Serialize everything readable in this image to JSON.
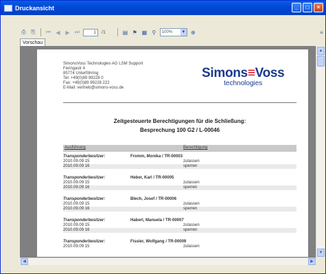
{
  "window": {
    "title": "Druckansicht"
  },
  "toolbar": {
    "page_value": "1",
    "page_total": "/1",
    "zoom_value": "100%"
  },
  "tabs": [
    {
      "label": "Vorschau"
    }
  ],
  "report": {
    "address_lines": [
      "SimonsVoss Technologies AG LSM Support",
      "Feringastr 4",
      "85774 Unterföhring",
      "Tel: +49(0)89 99228 0",
      "Fax: +49(0)89 99228 222",
      "E-Mail: vertrieb@simons-voss.de"
    ],
    "logo_brand_a": "Simons",
    "logo_brand_eq": "≡",
    "logo_brand_b": "Voss",
    "logo_tag": "technologies",
    "heading_line1": "Zeitgesteuerte Berechtigungen für die Schließung:",
    "heading_line2": "Besprechung 100 G2 / L-00046",
    "col_ausfuehrung": "Ausführung",
    "col_berechtigung": "Berechtigung",
    "entries": [
      {
        "label": "Transponderbesitzer:",
        "who": "Fromm, Monika / TR-00003",
        "rows": [
          {
            "date": "2010.09.09 15",
            "state": "zulassen"
          },
          {
            "date": "2010.09.09 16",
            "state": "sperren"
          }
        ]
      },
      {
        "label": "Transponderbesitzer:",
        "who": "Heber, Karl / TR-00005",
        "rows": [
          {
            "date": "2010.09.09 15",
            "state": "zulassen"
          },
          {
            "date": "2010.09.09 16",
            "state": "sperren"
          }
        ]
      },
      {
        "label": "Transponderbesitzer:",
        "who": "Blech, Josef / TR-00006",
        "rows": [
          {
            "date": "2010.09.09 15",
            "state": "zulassen"
          },
          {
            "date": "2010.09.09 16",
            "state": "sperren"
          }
        ]
      },
      {
        "label": "Transponderbesitzer:",
        "who": "Haberl, Manuela / TR-00007",
        "rows": [
          {
            "date": "2010.09.09 15",
            "state": "zulassen"
          },
          {
            "date": "2010.09.09 16",
            "state": "sperren"
          }
        ]
      },
      {
        "label": "Transponderbesitzer:",
        "who": "Fissler, Wolfgang / TR-00009",
        "rows": [
          {
            "date": "2010.09.09 15",
            "state": "zulassen"
          }
        ]
      }
    ]
  },
  "colors": {
    "titlebar": "#0049d6",
    "brand": "#1a3a8c",
    "brand_accent": "#e3001b"
  }
}
